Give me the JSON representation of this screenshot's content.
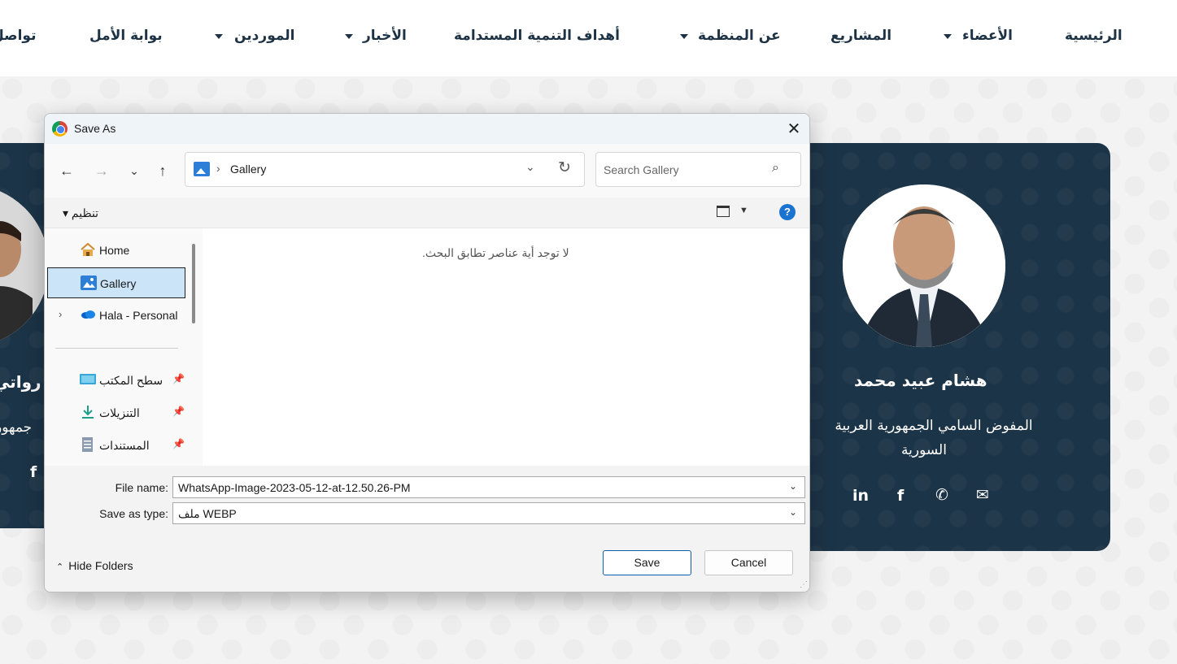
{
  "nav": {
    "items": [
      {
        "label": "الرئيسية",
        "has_dropdown": false
      },
      {
        "label": "الأعضاء",
        "has_dropdown": true
      },
      {
        "label": "المشاريع",
        "has_dropdown": false
      },
      {
        "label": "عن المنظمة",
        "has_dropdown": true
      },
      {
        "label": "أهداف التنمية المستدامة",
        "has_dropdown": false
      },
      {
        "label": "الأخبار",
        "has_dropdown": true
      },
      {
        "label": "الموردين",
        "has_dropdown": true
      },
      {
        "label": "بوابة الأمل",
        "has_dropdown": false
      },
      {
        "label": "تواصل",
        "has_dropdown": false
      }
    ]
  },
  "cards": {
    "right": {
      "name": "هشام عبيد محمد",
      "title_line1": "المفوض السامي الجمهورية العربية",
      "title_line2": "السورية",
      "social": [
        "linkedin-icon",
        "facebook-icon",
        "phone-icon",
        "envelope-icon"
      ]
    },
    "left": {
      "name_fragment": "رواتي",
      "title_fragment": "جمهور"
    }
  },
  "dialog": {
    "title": "Save As",
    "close_symbol": "✕",
    "address": {
      "location": "Gallery",
      "separator": "›"
    },
    "search": {
      "placeholder": "Search Gallery"
    },
    "command_bar": {
      "organize_label": "تنظيم ▾",
      "help_symbol": "?"
    },
    "sidebar": {
      "items": [
        {
          "label": "Home",
          "icon": "home-icon",
          "selected": false
        },
        {
          "label": "Gallery",
          "icon": "gallery-icon",
          "selected": true
        },
        {
          "label": "Hala - Personal",
          "icon": "onedrive-icon",
          "selected": false,
          "expandable": true
        },
        {
          "label": "سطح المكتب",
          "icon": "desktop-icon",
          "pinned": true
        },
        {
          "label": "التنزيلات",
          "icon": "downloads-icon",
          "pinned": true
        },
        {
          "label": "المستندات",
          "icon": "documents-icon",
          "pinned": true
        }
      ]
    },
    "content": {
      "empty_message": "لا توجد أية عناصر تطابق البحث."
    },
    "file_name": {
      "label": "File name:",
      "value": "WhatsApp-Image-2023-05-12-at-12.50.26-PM"
    },
    "save_as_type": {
      "label": "Save as type:",
      "value": "ملف WEBP"
    },
    "buttons": {
      "hide_folders": "Hide Folders",
      "save": "Save",
      "cancel": "Cancel"
    }
  },
  "colors": {
    "nav_text": "#1d3345",
    "card_bg": "#1c3447",
    "dialog_accent": "#0b5cad",
    "selection_bg": "#cce4f7"
  }
}
